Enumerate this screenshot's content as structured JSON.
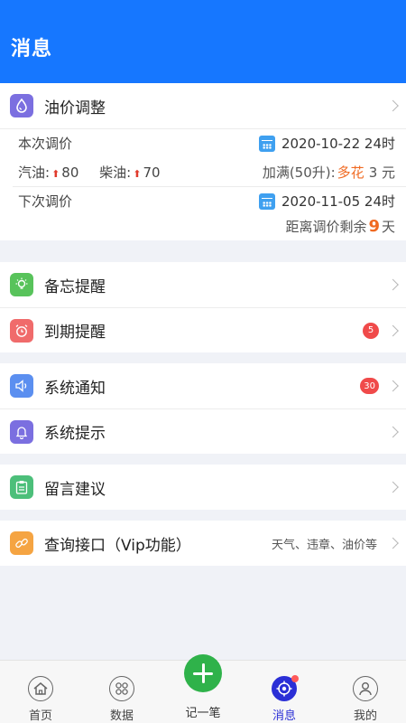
{
  "header": {
    "title": "消息"
  },
  "oil": {
    "title": "油价调整",
    "current_label": "本次调价",
    "current_date": "2020-10-22 24时",
    "gasoline_label": "汽油:",
    "gasoline_value": "80",
    "diesel_label": "柴油:",
    "diesel_value": "70",
    "fill_prefix": "加满(50升):",
    "fill_word": "多花",
    "fill_amount": "3 元",
    "next_label": "下次调价",
    "next_date": "2020-11-05 24时",
    "remain_prefix": "距离调价剩余",
    "remain_days": "9",
    "remain_suffix": "天"
  },
  "reminders": [
    {
      "label": "备忘提醒",
      "badge": ""
    },
    {
      "label": "到期提醒",
      "badge": "5"
    }
  ],
  "notices": [
    {
      "label": "系统通知",
      "badge": "30"
    },
    {
      "label": "系统提示",
      "badge": ""
    }
  ],
  "feedback": {
    "label": "留言建议"
  },
  "query": {
    "label": "查询接口（Vip功能）",
    "hint": "天气、违章、油价等"
  },
  "tabs": [
    {
      "label": "首页"
    },
    {
      "label": "数据"
    },
    {
      "label": "记一笔"
    },
    {
      "label": "消息"
    },
    {
      "label": "我的"
    }
  ],
  "colors": {
    "header": "#1677ff",
    "accent_orange": "#f06a22",
    "badge_red": "#f04a4a",
    "add_green": "#2fb24a",
    "active_tab": "#2b2fd6"
  }
}
